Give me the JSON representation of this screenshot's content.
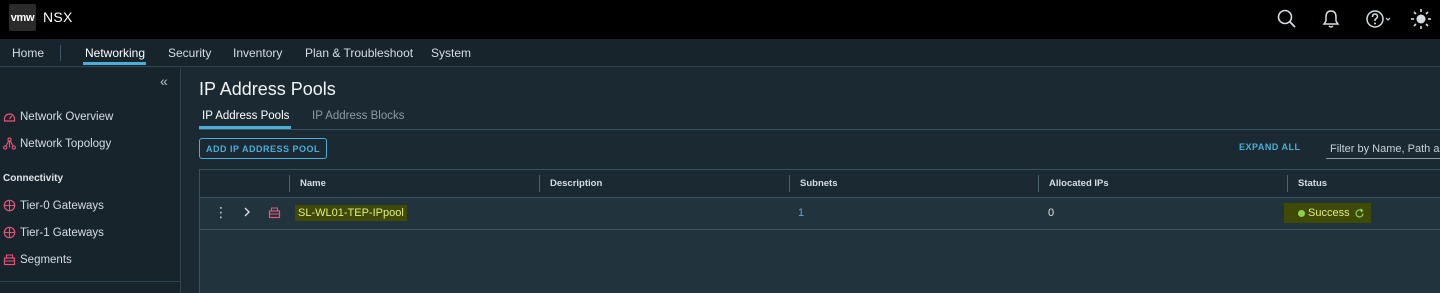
{
  "header": {
    "logo_text": "vmw",
    "product_name": "NSX",
    "icons": [
      "search-icon",
      "bell-icon",
      "help-icon",
      "theme-sun-icon"
    ]
  },
  "nav": {
    "items": [
      {
        "label": "Home"
      },
      {
        "label": "Networking",
        "active": true
      },
      {
        "label": "Security"
      },
      {
        "label": "Inventory"
      },
      {
        "label": "Plan & Troubleshoot"
      },
      {
        "label": "System"
      }
    ]
  },
  "sidebar": {
    "collapse_glyph": "«",
    "items": [
      {
        "label": "Network Overview",
        "icon": "network-overview-icon"
      },
      {
        "label": "Network Topology",
        "icon": "network-topology-icon"
      }
    ],
    "section": "Connectivity",
    "connectivity_items": [
      {
        "label": "Tier-0 Gateways",
        "icon": "tier0-gateway-icon"
      },
      {
        "label": "Tier-1 Gateways",
        "icon": "tier1-gateway-icon"
      },
      {
        "label": "Segments",
        "icon": "segments-icon"
      }
    ]
  },
  "main": {
    "title": "IP Address Pools",
    "tabs": [
      {
        "label": "IP Address Pools",
        "active": true
      },
      {
        "label": "IP Address Blocks"
      }
    ],
    "add_button": "ADD IP ADDRESS POOL",
    "expand_all": "EXPAND ALL",
    "filter_placeholder": "Filter by Name, Path and more"
  },
  "table": {
    "columns": [
      "Name",
      "Description",
      "Subnets",
      "Allocated IPs",
      "Status"
    ],
    "rows": [
      {
        "name": "SL-WL01-TEP-IPpool",
        "description": "",
        "subnets": "1",
        "allocated_ips": "0",
        "status": "Success"
      }
    ]
  },
  "colors": {
    "accent": "#49afd9",
    "header_bg": "#000000",
    "highlight_bg": "#3e4a06",
    "highlight_text": "#e5ee7c",
    "status_dot": "#8dd14b",
    "icon_pink": "#e8537a"
  }
}
